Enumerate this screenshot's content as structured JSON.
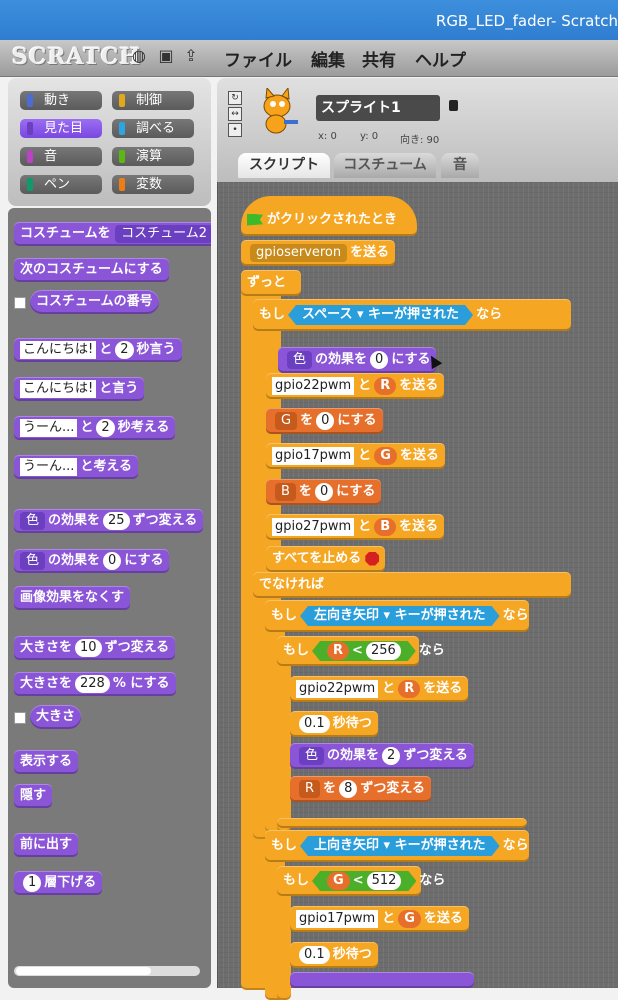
{
  "window": {
    "title": "RGB_LED_fader- Scratch"
  },
  "menubar": {
    "logo": "SCRATCH",
    "menus": [
      "ファイル",
      "編集",
      "共有",
      "ヘルプ"
    ]
  },
  "categories": [
    {
      "label": "動き",
      "color": "#4a6cd4"
    },
    {
      "label": "制御",
      "color": "#e1a91a"
    },
    {
      "label": "見た目",
      "color": "#8a55d7",
      "selected": true
    },
    {
      "label": "調べる",
      "color": "#2ca5e2"
    },
    {
      "label": "音",
      "color": "#bb42c3"
    },
    {
      "label": "演算",
      "color": "#5cb712"
    },
    {
      "label": "ペン",
      "color": "#0e9a6c"
    },
    {
      "label": "変数",
      "color": "#ee7d16"
    }
  ],
  "palette": {
    "costume_to": "コスチュームを",
    "costume_drop": "コスチューム2",
    "next_costume": "次のコスチュームにする",
    "costume_num": "コスチュームの番号",
    "say_for_txt": "こんにちは!",
    "say_for_and": "と",
    "say_for_num": "2",
    "say_for_tail": "秒言う",
    "say_txt": "こんにちは!",
    "say_tail": "と言う",
    "think_for_txt": "うーん...",
    "think_for_and": "と",
    "think_for_num": "2",
    "think_for_tail": "秒考える",
    "think_txt": "うーん...",
    "think_tail": "と考える",
    "change_effect_drop": "色",
    "change_effect_mid": "の効果を",
    "change_effect_num": "25",
    "change_effect_tail": "ずつ変える",
    "set_effect_drop": "色",
    "set_effect_mid": "の効果を",
    "set_effect_num": "0",
    "set_effect_tail": "にする",
    "clear_effects": "画像効果をなくす",
    "change_size_head": "大きさを",
    "change_size_num": "10",
    "change_size_tail": "ずつ変える",
    "set_size_head": "大きさを",
    "set_size_num": "228",
    "set_size_tail": "% にする",
    "size": "大きさ",
    "show": "表示する",
    "hide": "隠す",
    "go_front": "前に出す",
    "go_back_num": "1",
    "go_back_tail": "層下げる"
  },
  "sprite": {
    "name": "スプライト1",
    "x_label": "x: 0",
    "y_label": "y: 0",
    "dir_label": "向き: 90"
  },
  "tabs": [
    "スクリプト",
    "コスチューム",
    "音"
  ],
  "script": {
    "hat": "がクリックされたとき",
    "broadcast_server": "gpioserveron",
    "send": "を送る",
    "forever": "ずっと",
    "if": "もし",
    "then": "なら",
    "else": "でなければ",
    "key_space": "スペース",
    "key_left": "左向き矢印",
    "key_up": "上向き矢印",
    "key_pressed": "キーが押された",
    "effect_color": "色",
    "effect_mid": "の効果を",
    "effect_zero": "0",
    "effect_set_tail": "にする",
    "gpio22": "gpio22pwm",
    "gpio17": "gpio17pwm",
    "gpio27": "gpio27pwm",
    "and": "と",
    "var_R": "R",
    "var_G": "G",
    "var_B": "B",
    "to": "を",
    "zero": "0",
    "set_tail": "にする",
    "stop_all": "すべてを止める",
    "lt": "<",
    "limit_256": "256",
    "limit_512": "512",
    "wait_num": "0.1",
    "wait_tail": "秒待つ",
    "change_effect_num": "2",
    "change_tail": "ずつ変える",
    "r_step": "8"
  }
}
